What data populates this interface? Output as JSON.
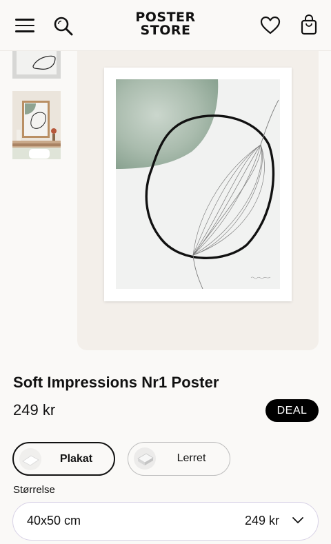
{
  "header": {
    "logo_line1": "POSTER",
    "logo_line2": "STORE",
    "icons": [
      "menu-icon",
      "search-icon",
      "heart-icon",
      "bag-icon"
    ]
  },
  "product": {
    "title": "Soft Impressions Nr1 Poster",
    "price": "249 kr",
    "badge": "DEAL"
  },
  "material_options": [
    {
      "label": "Plakat",
      "selected": true
    },
    {
      "label": "Lerret",
      "selected": false
    }
  ],
  "size": {
    "label": "Størrelse",
    "selected_value": "40x50 cm",
    "selected_price": "249 kr"
  },
  "colors": {
    "accent": "#000000",
    "background": "#faf9f7",
    "image_bg": "#f3efea",
    "select_border": "#d8d2e6"
  }
}
